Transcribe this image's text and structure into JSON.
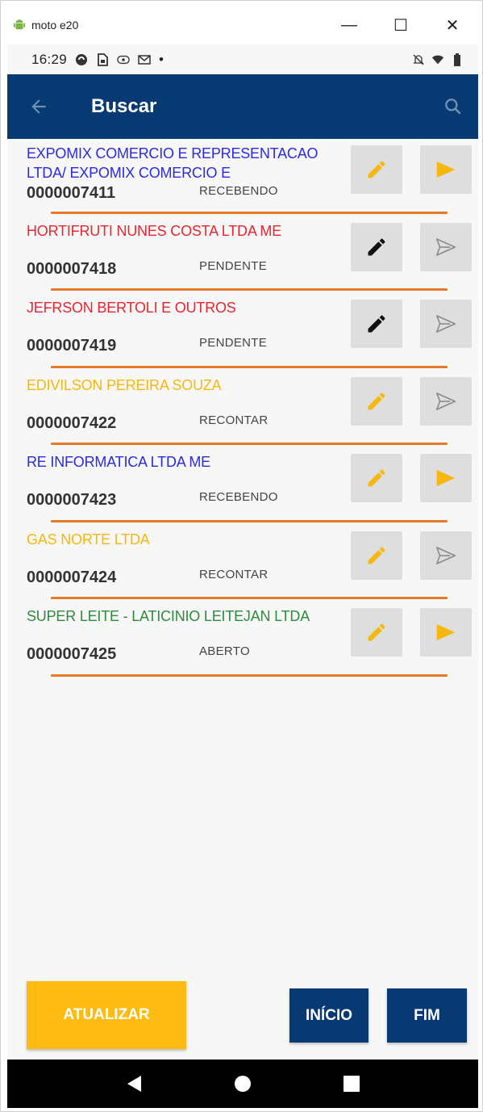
{
  "window": {
    "title": "moto e20",
    "minimize_label": "—",
    "maximize_label": "☐",
    "close_label": "✕"
  },
  "status_bar": {
    "time": "16:29",
    "dot": "•"
  },
  "app_bar": {
    "title": "Buscar"
  },
  "rows": [
    {
      "name": "EXPOMIX COMERCIO E REPRESENTACAO LTDA/ EXPOMIX COMERCIO E",
      "code": "0000007411",
      "status": "RECEBENDO",
      "name_color": "#2b2be0",
      "edit_icon_color": "#f6b80f",
      "send_icon": "filled",
      "send_icon_color": "#f6b80f"
    },
    {
      "name": "HORTIFRUTI NUNES COSTA LTDA  ME",
      "code": "0000007418",
      "status": "PENDENTE",
      "name_color": "#e8262f",
      "edit_icon_color": "#111111",
      "send_icon": "outline",
      "send_icon_color": "#8a8a8a"
    },
    {
      "name": "JEFRSON BERTOLI E OUTROS",
      "code": "0000007419",
      "status": "PENDENTE",
      "name_color": "#e8262f",
      "edit_icon_color": "#111111",
      "send_icon": "outline",
      "send_icon_color": "#8a8a8a"
    },
    {
      "name": "EDIVILSON PEREIRA SOUZA",
      "code": "0000007422",
      "status": "RECONTAR",
      "name_color": "#f6b80f",
      "edit_icon_color": "#f6b80f",
      "send_icon": "outline",
      "send_icon_color": "#8a8a8a"
    },
    {
      "name": "RE INFORMATICA LTDA ME",
      "code": "0000007423",
      "status": "RECEBENDO",
      "name_color": "#2b2be0",
      "edit_icon_color": "#f6b80f",
      "send_icon": "filled",
      "send_icon_color": "#f6b80f"
    },
    {
      "name": "GAS NORTE LTDA",
      "code": "0000007424",
      "status": "RECONTAR",
      "name_color": "#f6b80f",
      "edit_icon_color": "#f6b80f",
      "send_icon": "outline",
      "send_icon_color": "#8a8a8a"
    },
    {
      "name": "SUPER LEITE - LATICINIO LEITEJAN LTDA",
      "code": "0000007425",
      "status": "ABERTO",
      "name_color": "#2e8b3e",
      "edit_icon_color": "#f6b80f",
      "send_icon": "filled",
      "send_icon_color": "#f6b80f"
    }
  ],
  "buttons": {
    "atualizar": "ATUALIZAR",
    "inicio": "INÍCIO",
    "fim": "FIM"
  },
  "colors": {
    "app_bar": "#073a73",
    "accent_yellow": "#fdbb13",
    "separator": "#e4792a"
  }
}
